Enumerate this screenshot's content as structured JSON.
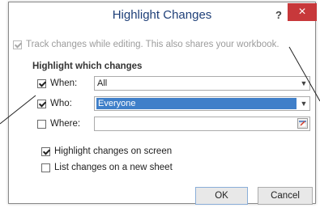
{
  "dialog": {
    "title": "Highlight Changes",
    "help_label": "?",
    "close_label": "×"
  },
  "track_changes": {
    "label": "Track changes while editing. This also shares your workbook.",
    "checked": true,
    "enabled": false
  },
  "highlight_section": {
    "heading": "Highlight which changes",
    "when": {
      "label": "When:",
      "checked": true,
      "value": "All"
    },
    "who": {
      "label": "Who:",
      "checked": true,
      "value": "Everyone"
    },
    "where": {
      "label": "Where:",
      "checked": false,
      "value": ""
    }
  },
  "options": {
    "highlight_on_screen": {
      "label": "Highlight changes on screen",
      "checked": true
    },
    "list_on_new_sheet": {
      "label": "List changes on a new sheet",
      "checked": false
    }
  },
  "buttons": {
    "ok_label": "OK",
    "cancel_label": "Cancel"
  },
  "icons": {
    "dropdown": "chevron-down-icon",
    "range_picker": "collapse-dialog-icon"
  }
}
